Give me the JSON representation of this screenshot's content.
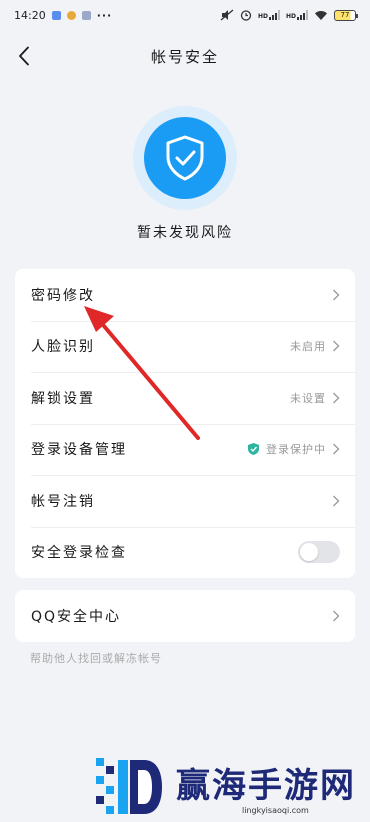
{
  "status_bar": {
    "time": "14:20",
    "dots": "···",
    "battery": "77",
    "signal_tag": "HD"
  },
  "nav": {
    "title": "帐号安全",
    "back_icon": "chevron-left-icon"
  },
  "shield": {
    "icon": "shield-check-icon",
    "status_text": "暂未发现风险",
    "color": "#1a9cf4"
  },
  "settings": [
    {
      "label": "密码修改",
      "value": ""
    },
    {
      "label": "人脸识别",
      "value": "未启用"
    },
    {
      "label": "解锁设置",
      "value": "未设置"
    },
    {
      "label": "登录设备管理",
      "value": "登录保护中"
    },
    {
      "label": "帐号注销",
      "value": ""
    },
    {
      "label": "安全登录检查",
      "toggle": false
    }
  ],
  "qq_center": {
    "label": "QQ安全中心",
    "helper": "帮助他人找回或解冻帐号"
  },
  "watermark": {
    "text": "赢海手游网",
    "url": "lingkyisaoqi.com"
  }
}
